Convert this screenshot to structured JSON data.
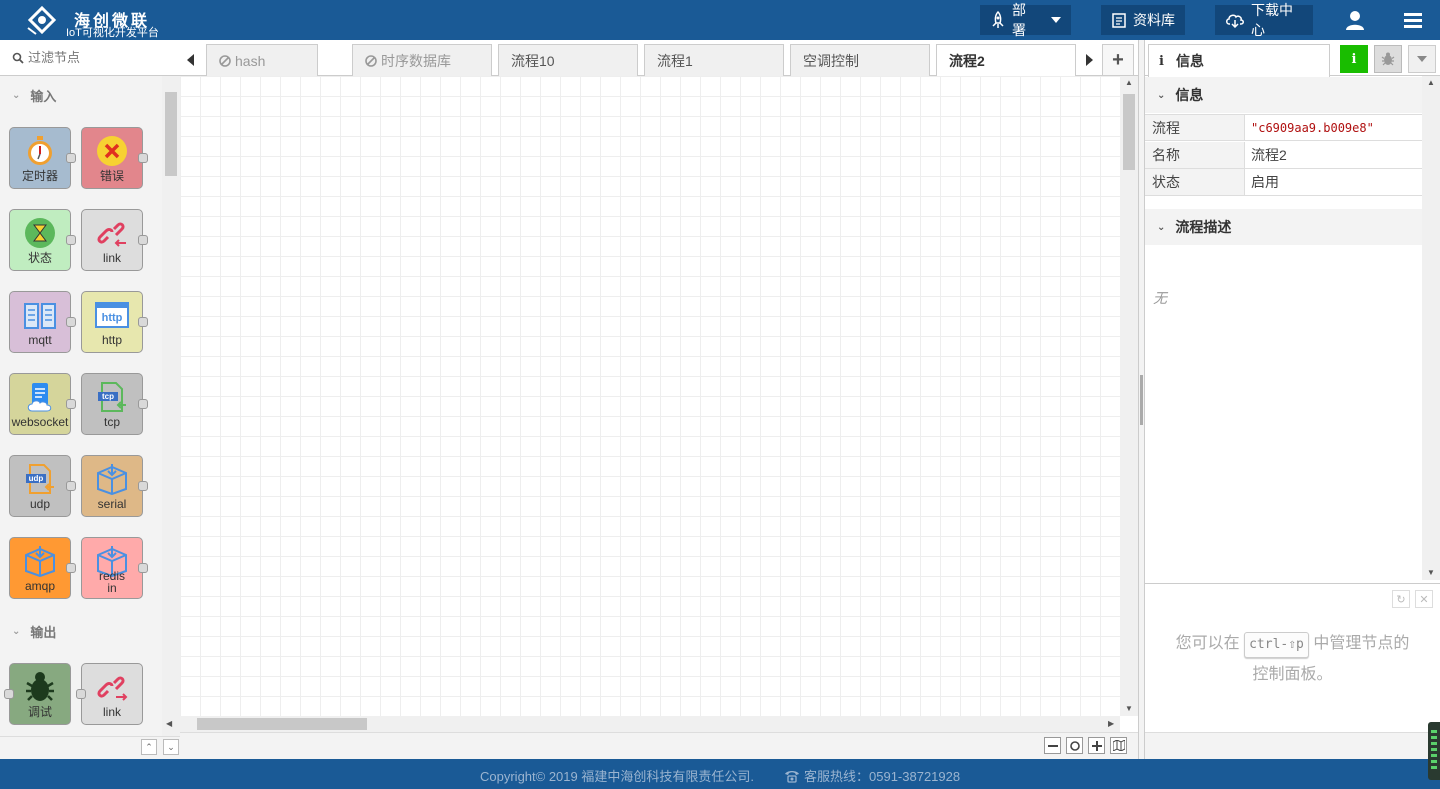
{
  "header": {
    "brand_cn": "海创微联",
    "brand_sub": "IoT可视化开发平台",
    "deploy_label": "部署",
    "library_label": "资料库",
    "download_label": "下载中心",
    "icons": [
      "rocket-icon",
      "library-icon",
      "cloud-download-icon",
      "user-icon",
      "menu-icon"
    ],
    "colors": {
      "bar": "#1a5a96",
      "button": "#12477a"
    }
  },
  "palette": {
    "search_placeholder": "过滤节点",
    "categories": [
      {
        "label": "输入",
        "nodes": [
          {
            "label": "定时器",
            "icon": "timer-icon",
            "color": "#a6bbcf"
          },
          {
            "label": "错误",
            "icon": "error-icon",
            "color": "#e2868c"
          },
          {
            "label": "状态",
            "icon": "status-icon",
            "color": "#c0edc0"
          },
          {
            "label": "link",
            "icon": "link-in-icon",
            "color": "#dddddd"
          },
          {
            "label": "mqtt",
            "icon": "book-icon",
            "color": "#d8bfd8"
          },
          {
            "label": "http",
            "icon": "http-icon",
            "color": "#e7e7ae"
          },
          {
            "label": "websocket",
            "icon": "websocket-icon",
            "color": "#d5d59b"
          },
          {
            "label": "tcp",
            "icon": "tcp-icon",
            "color": "#c0c0c0"
          },
          {
            "label": "udp",
            "icon": "udp-icon",
            "color": "#c0c0c0"
          },
          {
            "label": "serial",
            "icon": "serial-icon",
            "color": "#deb887"
          },
          {
            "label": "amqp",
            "icon": "amqp-icon",
            "color": "#ff9933"
          },
          {
            "label_line1": "redis",
            "label_line2": "in",
            "icon": "redis-icon",
            "color": "#ffaaaa"
          }
        ]
      },
      {
        "label": "输出",
        "nodes": [
          {
            "label": "调试",
            "icon": "bug-icon",
            "color": "#87a980"
          },
          {
            "label": "link",
            "icon": "link-out-icon",
            "color": "#dddddd"
          }
        ]
      }
    ]
  },
  "workspace": {
    "tabs": [
      {
        "label": "hash",
        "disabled": true
      },
      {
        "label": "时序数据库",
        "disabled": true
      },
      {
        "label": "流程10",
        "disabled": false
      },
      {
        "label": "流程1",
        "disabled": false
      },
      {
        "label": "空调控制",
        "disabled": false
      },
      {
        "label": "流程2",
        "disabled": false,
        "active": true
      }
    ],
    "add_tab_label": "+"
  },
  "sidebar": {
    "tab_label": "信息",
    "info_section": "信息",
    "rows": [
      {
        "key": "流程",
        "value": "\"c6909aa9.b009e8\""
      },
      {
        "key": "名称",
        "value": "流程2"
      },
      {
        "key": "状态",
        "value": "启用"
      }
    ],
    "desc_section": "流程描述",
    "desc_value": "无",
    "tip_before": "您可以在",
    "tip_kbd": "ctrl-⇧p",
    "tip_after": "中管理节点的",
    "tip_line2": "控制面板。"
  },
  "footer": {
    "copyright": "Copyright© 2019 福建中海创科技有限责任公司.",
    "hotline": "客服热线：0591-38721928"
  }
}
